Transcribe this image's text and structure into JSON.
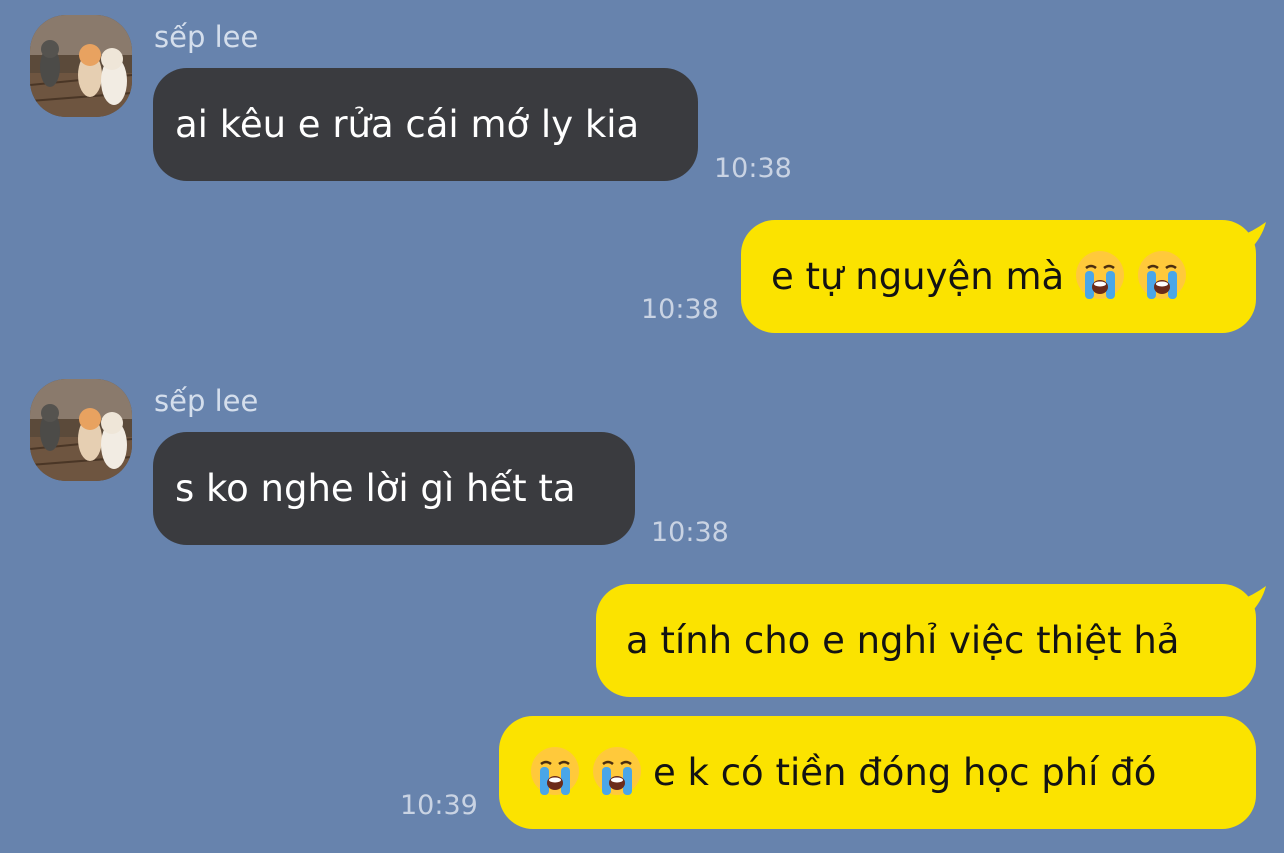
{
  "conversation": {
    "messages": [
      {
        "direction": "incoming",
        "sender": "sếp lee",
        "text": "ai kêu e rửa cái mớ ly kia",
        "time": "10:38"
      },
      {
        "direction": "outgoing",
        "text": "e tự nguyện mà",
        "emoji_after": [
          "crying-face",
          "crying-face"
        ],
        "time": "10:38"
      },
      {
        "direction": "incoming",
        "sender": "sếp lee",
        "text": "s ko nghe lời gì hết ta",
        "time": "10:38"
      },
      {
        "direction": "outgoing",
        "text": "a tính cho e nghỉ việc thiệt hả"
      },
      {
        "direction": "outgoing",
        "text": "e k có tiền đóng học phí đó",
        "emoji_before": [
          "crying-face",
          "crying-face"
        ],
        "time": "10:39"
      }
    ]
  },
  "colors": {
    "background": "#6783ad",
    "incoming_bubble": "#3a3b3f",
    "outgoing_bubble": "#fbe300"
  }
}
